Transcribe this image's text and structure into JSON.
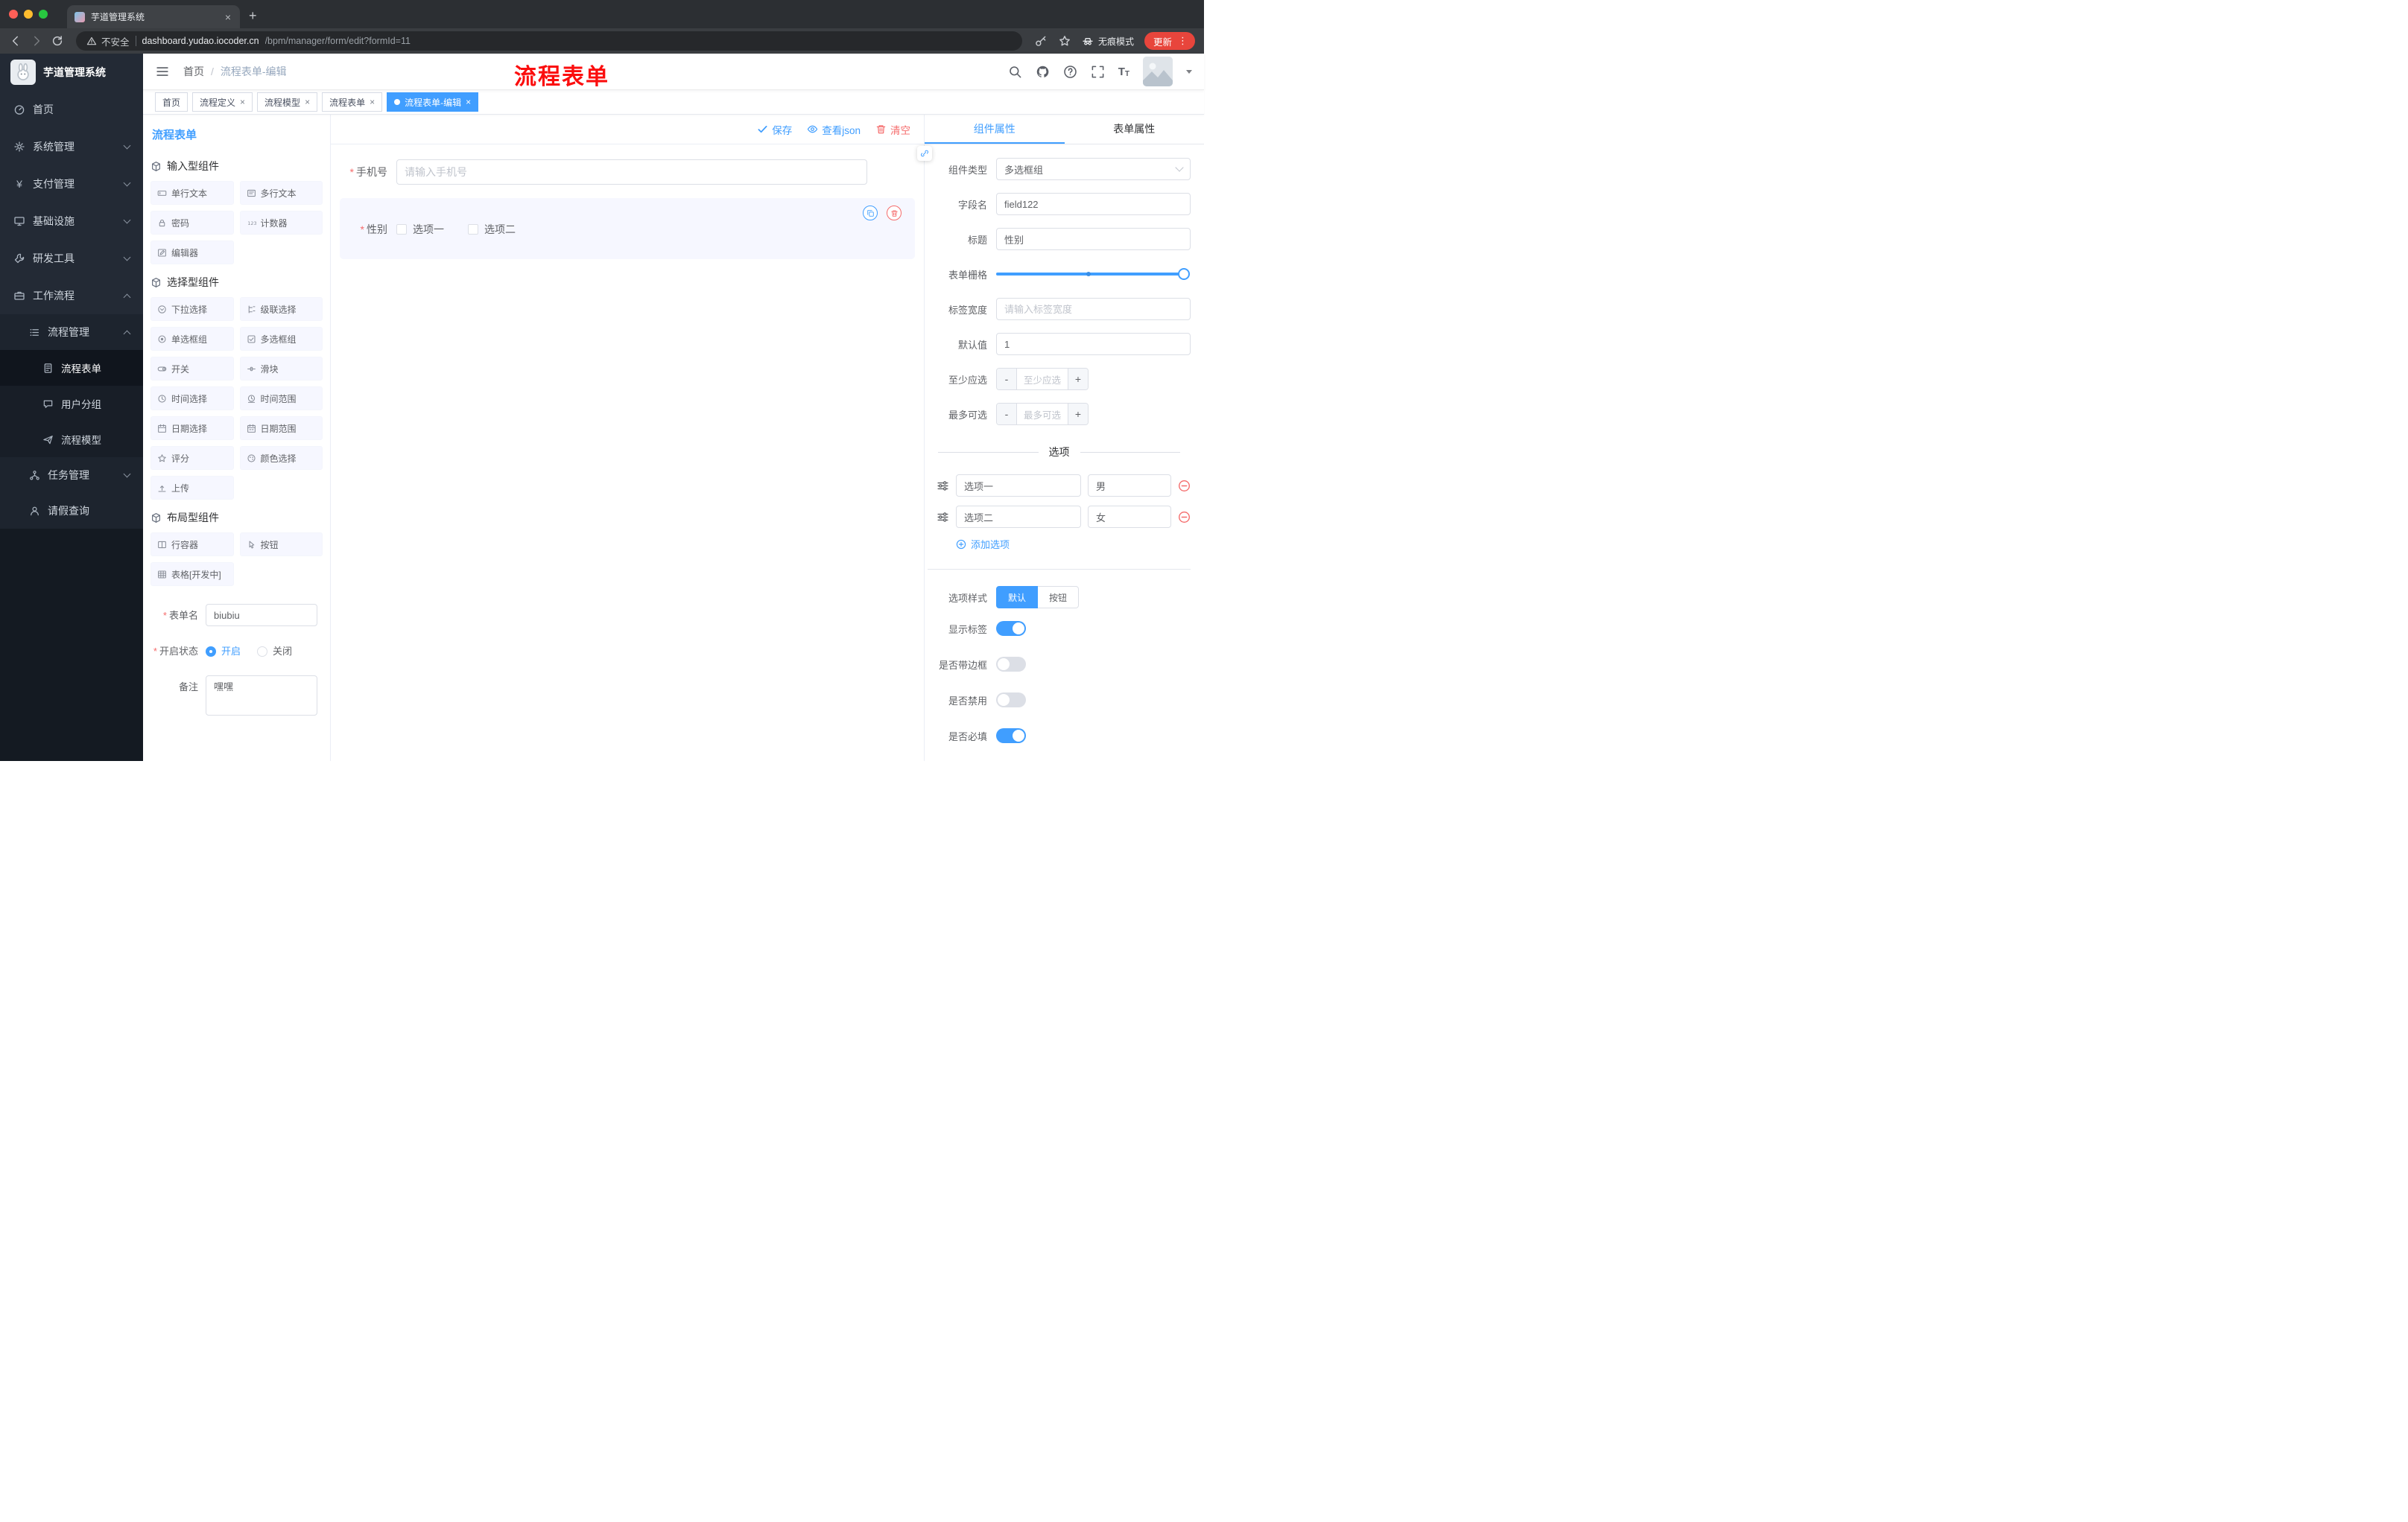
{
  "glyphs": {
    "close": "×",
    "plus": "+",
    "dots": "⋮",
    "slash": "/",
    "asterisk": "*",
    "minus": "-",
    "yen": "¥"
  },
  "annotation": {
    "text": "流程表单"
  },
  "browser": {
    "tab_title": "芋道管理系统",
    "security_label": "不安全",
    "url_host": "dashboard.yudao.iocoder.cn",
    "url_path": "/bpm/manager/form/edit?formId=11",
    "incognito_label": "无痕模式",
    "update_label": "更新"
  },
  "sidebar": {
    "logo_title": "芋道管理系统",
    "items": [
      {
        "label": "首页"
      },
      {
        "label": "系统管理"
      },
      {
        "label": "支付管理"
      },
      {
        "label": "基础设施"
      },
      {
        "label": "研发工具"
      },
      {
        "label": "工作流程"
      },
      {
        "label": "流程管理"
      },
      {
        "label": "流程表单"
      },
      {
        "label": "用户分组"
      },
      {
        "label": "流程模型"
      },
      {
        "label": "任务管理"
      },
      {
        "label": "请假查询"
      }
    ]
  },
  "header": {
    "breadcrumb_home": "首页",
    "breadcrumb_current": "流程表单-编辑"
  },
  "tags": {
    "items": [
      {
        "label": "首页"
      },
      {
        "label": "流程定义"
      },
      {
        "label": "流程模型"
      },
      {
        "label": "流程表单"
      },
      {
        "label": "流程表单-编辑"
      }
    ]
  },
  "library": {
    "title": "流程表单",
    "groups": [
      {
        "title": "输入型组件",
        "items": [
          {
            "label": "单行文本"
          },
          {
            "label": "多行文本"
          },
          {
            "label": "密码"
          },
          {
            "label": "计数器"
          },
          {
            "label": "编辑器"
          }
        ]
      },
      {
        "title": "选择型组件",
        "items": [
          {
            "label": "下拉选择"
          },
          {
            "label": "级联选择"
          },
          {
            "label": "单选框组"
          },
          {
            "label": "多选框组"
          },
          {
            "label": "开关"
          },
          {
            "label": "滑块"
          },
          {
            "label": "时间选择"
          },
          {
            "label": "时间范围"
          },
          {
            "label": "日期选择"
          },
          {
            "label": "日期范围"
          },
          {
            "label": "评分"
          },
          {
            "label": "颜色选择"
          },
          {
            "label": "上传"
          }
        ]
      },
      {
        "title": "布局型组件",
        "items": [
          {
            "label": "行容器"
          },
          {
            "label": "按钮"
          },
          {
            "label": "表格[开发中]"
          }
        ]
      }
    ],
    "form": {
      "name_label": "表单名",
      "name_value": "biubiu",
      "status_label": "开启状态",
      "status_on": "开启",
      "status_off": "关闭",
      "remark_label": "备注",
      "remark_value": "嘿嘿"
    }
  },
  "canvas": {
    "toolbar": {
      "save": "保存",
      "view_json": "查看json",
      "clear": "清空"
    },
    "phone_label": "手机号",
    "phone_placeholder": "请输入手机号",
    "gender_label": "性别",
    "gender_opt1": "选项一",
    "gender_opt2": "选项二"
  },
  "props": {
    "tab_component": "组件属性",
    "tab_form": "表单属性",
    "type_label": "组件类型",
    "type_value": "多选框组",
    "field_label": "字段名",
    "field_value": "field122",
    "title_label": "标题",
    "title_value": "性别",
    "grid_label": "表单栅格",
    "labelwidth_label": "标签宽度",
    "labelwidth_placeholder": "请输入标签宽度",
    "default_label": "默认值",
    "default_value": "1",
    "min_label": "至少应选",
    "min_placeholder": "至少应选",
    "max_label": "最多可选",
    "max_placeholder": "最多可选",
    "options_title": "选项",
    "options": [
      {
        "label": "选项一",
        "value": "男"
      },
      {
        "label": "选项二",
        "value": "女"
      }
    ],
    "add_option": "添加选项",
    "style_label": "选项样式",
    "style_default": "默认",
    "style_button": "按钮",
    "switch_show_label": "显示标签",
    "switch_border": "是否带边框",
    "switch_disabled": "是否禁用",
    "switch_required": "是否必填"
  },
  "colors": {
    "accent": "#409eff",
    "danger": "#f56c6c",
    "annotation_red": "#fb0e0e",
    "sidebar_bg": "#232a35"
  }
}
